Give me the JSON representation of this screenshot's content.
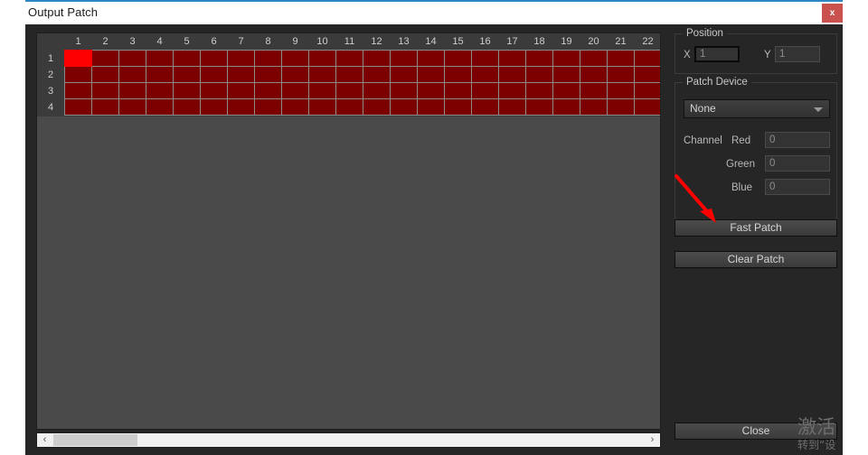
{
  "window": {
    "title": "Output Patch",
    "close_label": "x",
    "accent_color": "#2f88c4",
    "close_color": "#c9524f"
  },
  "grid": {
    "columns": [
      1,
      2,
      3,
      4,
      5,
      6,
      7,
      8,
      9,
      10,
      11,
      12,
      13,
      14,
      15,
      16,
      17,
      18,
      19,
      20,
      21,
      22
    ],
    "rows": [
      1,
      2,
      3,
      4
    ],
    "cell_color": "#7d0000",
    "selected_color": "#ff0000",
    "selected_cell": {
      "row": 1,
      "column": 1
    }
  },
  "scrollbar": {
    "left_arrow": "‹",
    "right_arrow": "›"
  },
  "panel": {
    "position": {
      "legend": "Position",
      "x_label": "X",
      "x_value": "1",
      "y_label": "Y",
      "y_value": "1"
    },
    "patch_device": {
      "legend": "Patch Device",
      "selected_option": "None",
      "channel_label": "Channel",
      "red_label": "Red",
      "red_value": "0",
      "green_label": "Green",
      "green_value": "0",
      "blue_label": "Blue",
      "blue_value": "0"
    },
    "buttons": {
      "fast_patch": "Fast Patch",
      "clear_patch": "Clear Patch",
      "close": "Close"
    }
  },
  "watermark": {
    "title": "激活",
    "subtitle": "转到“设",
    "color": "#6e6e6e"
  },
  "annotation": {
    "arrow_color": "#ff0000",
    "points_to": "Fast Patch"
  }
}
